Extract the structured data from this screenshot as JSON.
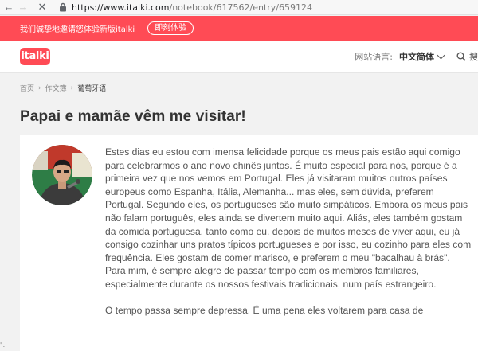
{
  "browser": {
    "back_icon": "←",
    "forward_icon": "→",
    "close_icon": "✕",
    "url_host": "https://www.italki.com",
    "url_path": "/notebook/617562/entry/659124"
  },
  "promo": {
    "text": "我们诚挚地邀请您体验新版italki",
    "button": "即刻体验"
  },
  "header": {
    "logo": "italki",
    "lang_label": "网站语言:",
    "lang_value": "中文简体",
    "search_label": "搜"
  },
  "breadcrumb": {
    "items": [
      "首页",
      "作文簿",
      "葡萄牙语"
    ],
    "separator": "›"
  },
  "entry": {
    "title": "Papai e mamãe vêm me visitar!",
    "paragraphs": [
      "Estes dias eu estou com imensa felicidade porque os meus pais estão aqui comigo para celebrarmos o ano novo chinês juntos. É muito especial para nós, porque é a primeira vez que nos vemos em Portugal. Eles já visitaram muitos outros países europeus como Espanha, Itália, Alemanha... mas eles, sem dúvida, preferem Portugal. Segundo eles, os portugueses são muito simpáticos. Embora os meus pais não falam português, eles ainda se divertem muito aqui. Aliás, eles também gostam da comida portuguesa, tanto como eu. depois de muitos meses de viver aqui, eu já consigo cozinhar uns pratos típicos portugueses e por isso, eu cozinho para eles com frequência. Eles gostam de comer marisco, e preferem o meu \"bacalhau à brás\". Para mim, é sempre alegre de passar tempo com os membros familiares, especialmente durante os nossos festivais tradicionais, num país estrangeiro.",
      "O tempo passa sempre depressa. É uma pena eles voltarem para casa de"
    ]
  },
  "statusbar": {
    "left": "\"."
  },
  "colors": {
    "brand": "#ff4b55",
    "text": "#555555",
    "title": "#333333"
  }
}
